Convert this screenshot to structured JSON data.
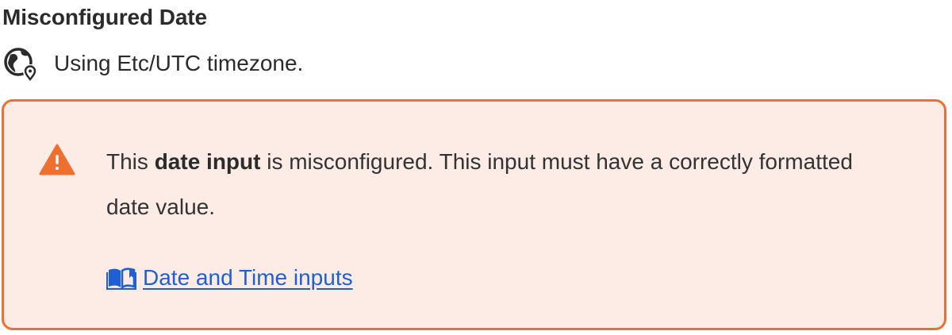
{
  "field": {
    "title": "Misconfigured Date",
    "timezone_icon": "globe-location-icon",
    "timezone_text": "Using Etc/UTC timezone."
  },
  "alert": {
    "icon": "warning-triangle-icon",
    "message_prefix": "This ",
    "message_bold": "date input",
    "message_suffix": " is misconfigured. This input must have a correctly formatted date value.",
    "link_icon": "book-icon",
    "link_text": "Date and Time inputs"
  },
  "colors": {
    "alert_border": "#ef6f2f",
    "alert_background": "#fdece5",
    "warning_icon": "#ef6f2f",
    "link": "#1f5fd6",
    "text": "#2b2b2b"
  }
}
